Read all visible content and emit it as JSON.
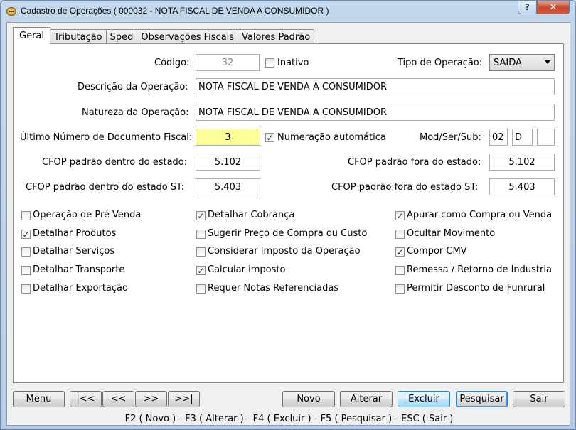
{
  "window": {
    "title": "Cadastro de Operações ( 000032 - NOTA FISCAL DE VENDA A CONSUMIDOR )",
    "help_label": "?",
    "close_label": "✕"
  },
  "tabs": [
    {
      "label": "Geral",
      "active": true
    },
    {
      "label": "Tributação"
    },
    {
      "label": "Sped"
    },
    {
      "label": "Observações Fiscais"
    },
    {
      "label": "Valores Padrão"
    }
  ],
  "form": {
    "codigo_label": "Código:",
    "codigo_value": "32",
    "inativo_label": "Inativo",
    "tipo_label": "Tipo de Operação:",
    "tipo_value": "SAIDA",
    "descricao_label": "Descrição da Operação:",
    "descricao_value": "NOTA FISCAL DE VENDA A CONSUMIDOR",
    "natureza_label": "Natureza da Operação:",
    "natureza_value": "NOTA FISCAL DE VENDA A CONSUMIDOR",
    "ultimo_label": "Último Número de Documento Fiscal:",
    "ultimo_value": "3",
    "numeracao_label": "Numeração automática",
    "mod_label": "Mod/Ser/Sub:",
    "mod_value": "02",
    "ser_value": "D",
    "sub_value": "",
    "cfop_dentro_label": "CFOP padrão dentro do estado:",
    "cfop_dentro_value": "5.102",
    "cfop_fora_label": "CFOP padrão fora do estado:",
    "cfop_fora_value": "5.102",
    "cfop_dentro_st_label": "CFOP padrão dentro do estado ST:",
    "cfop_dentro_st_value": "5.403",
    "cfop_fora_st_label": "CFOP padrão fora do estado ST:",
    "cfop_fora_st_value": "5.403"
  },
  "options": {
    "col1": [
      {
        "label": "Operação de Pré-Venda",
        "checked": false
      },
      {
        "label": "Detalhar Produtos",
        "checked": true
      },
      {
        "label": "Detalhar Serviços",
        "checked": false
      },
      {
        "label": "Detalhar Transporte",
        "checked": false
      },
      {
        "label": "Detalhar Exportação",
        "checked": false
      }
    ],
    "col2": [
      {
        "label": "Detalhar Cobrança",
        "checked": true
      },
      {
        "label": "Sugerir Preço de Compra ou Custo",
        "checked": false
      },
      {
        "label": "Considerar Imposto da Operação",
        "checked": false
      },
      {
        "label": "Calcular imposto",
        "checked": true
      },
      {
        "label": "Requer Notas Referenciadas",
        "checked": false
      }
    ],
    "col3": [
      {
        "label": "Apurar como Compra ou Venda",
        "checked": true
      },
      {
        "label": "Ocultar Movimento",
        "checked": false
      },
      {
        "label": "Compor CMV",
        "checked": true
      },
      {
        "label": "Remessa / Retorno de Industria",
        "checked": false
      },
      {
        "label": "Permitir Desconto de Funrural",
        "checked": false
      }
    ]
  },
  "buttons": {
    "menu": "Menu",
    "first": "|<<",
    "prev": "<<",
    "next": ">>",
    "last": ">>|",
    "novo": "Novo",
    "alterar": "Alterar",
    "excluir": "Excluir",
    "pesquisar": "Pesquisar",
    "sair": "Sair"
  },
  "shortcuts": "F2 ( Novo )  -  F3 ( Alterar )  -  F4 ( Excluir )  -  F5 ( Pesquisar )  -  ESC ( Sair )"
}
